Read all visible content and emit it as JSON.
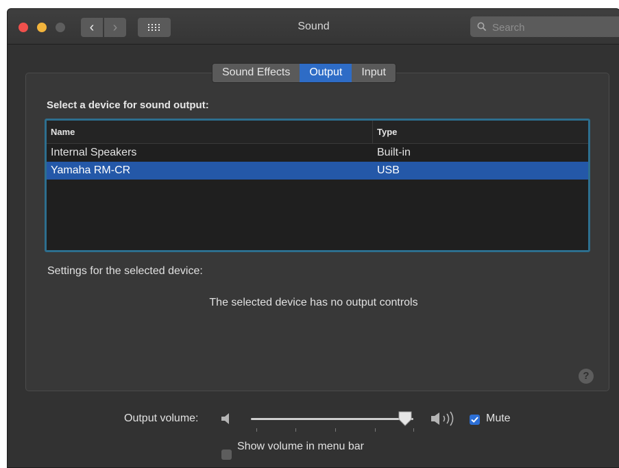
{
  "window": {
    "title": "Sound"
  },
  "search": {
    "placeholder": "Search"
  },
  "tabs": [
    {
      "label": "Sound Effects",
      "active": false
    },
    {
      "label": "Output",
      "active": true
    },
    {
      "label": "Input",
      "active": false
    }
  ],
  "output": {
    "heading": "Select a device for sound output:",
    "columns": {
      "name": "Name",
      "type": "Type"
    },
    "devices": [
      {
        "name": "Internal Speakers",
        "type": "Built-in",
        "selected": false
      },
      {
        "name": "Yamaha RM-CR",
        "type": "USB",
        "selected": true
      }
    ],
    "settings_label": "Settings for the selected device:",
    "no_controls_message": "The selected device has no output controls"
  },
  "help": {
    "symbol": "?"
  },
  "volume": {
    "label": "Output volume:",
    "level": 0.95,
    "mute_label": "Mute",
    "mute_checked": true,
    "menu_bar_label": "Show volume in menu bar",
    "menu_bar_checked": false
  },
  "colors": {
    "accent": "#2e6cc6",
    "selection": "#2458a8",
    "window_bg": "#323232",
    "close": "#f0504c",
    "minimize": "#f2b43c"
  },
  "icons": {
    "back": "chevron-left-icon",
    "forward": "chevron-right-icon",
    "show_all": "grid-icon",
    "search": "search-icon",
    "volume_low": "speaker-low-icon",
    "volume_high": "speaker-high-icon"
  }
}
